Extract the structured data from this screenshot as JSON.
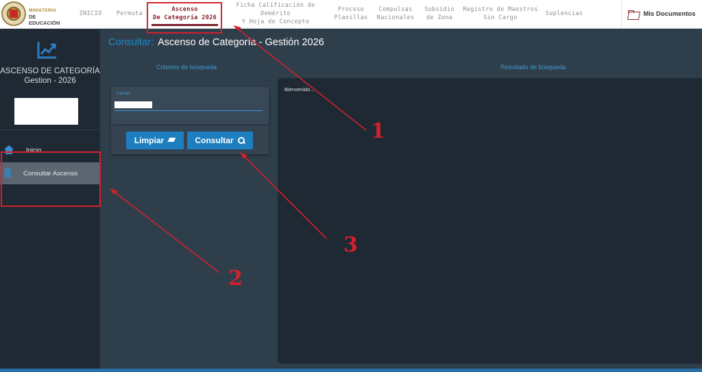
{
  "brand": {
    "top": "MINISTERIO",
    "bottom": "DE EDUCACIÓN"
  },
  "nav": {
    "items": [
      {
        "line1": "INICIO",
        "line2": ""
      },
      {
        "line1": "Permuta",
        "line2": ""
      },
      {
        "line1": "Ascenso",
        "line2": "De Categoría 2026"
      },
      {
        "line1": "Ficha Calificación de Demérito",
        "line2": "Y Hoja de Concepto"
      },
      {
        "line1": "Proceso",
        "line2": "Planillas"
      },
      {
        "line1": "Compulsas",
        "line2": "Nacionales"
      },
      {
        "line1": "Subsidio",
        "line2": "de Zona"
      },
      {
        "line1": "Registro de Maestros",
        "line2": "Sin Cargo"
      },
      {
        "line1": "Suplencias",
        "line2": ""
      }
    ],
    "active_index": 2,
    "mis_documentos": "Mis Documentos",
    "mis_documentos_icon": "folder-open-icon"
  },
  "sidebar": {
    "icon": "line-chart-icon",
    "title_line1": "ASCENSO DE CATEGORÍA",
    "title_line2": "Gestion - 2026",
    "items": [
      {
        "label": "Inicio",
        "icon": "home-icon"
      },
      {
        "label": "Consultar Ascenso",
        "icon": "document-icon"
      }
    ]
  },
  "main": {
    "title_prefix": "Consultar:",
    "title": "Ascenso de Categoría - Gestión 2026",
    "criteria_header": "Criterios de búsqueda",
    "results_header": "Resultado de búsqueda",
    "field_label": "Carnet",
    "field_value": "",
    "buttons": {
      "limpiar": "Limpiar",
      "consultar": "Consultar"
    },
    "results_text": "Bienvenido..."
  },
  "annotations": {
    "one": "1",
    "two": "2",
    "three": "3"
  },
  "colors": {
    "accent": "#1d7fc0",
    "active_nav": "#8a1f2a",
    "annotation_red": "#d3212d",
    "sidebar_bg": "#1e2934",
    "main_bg": "#2f3e4b"
  }
}
